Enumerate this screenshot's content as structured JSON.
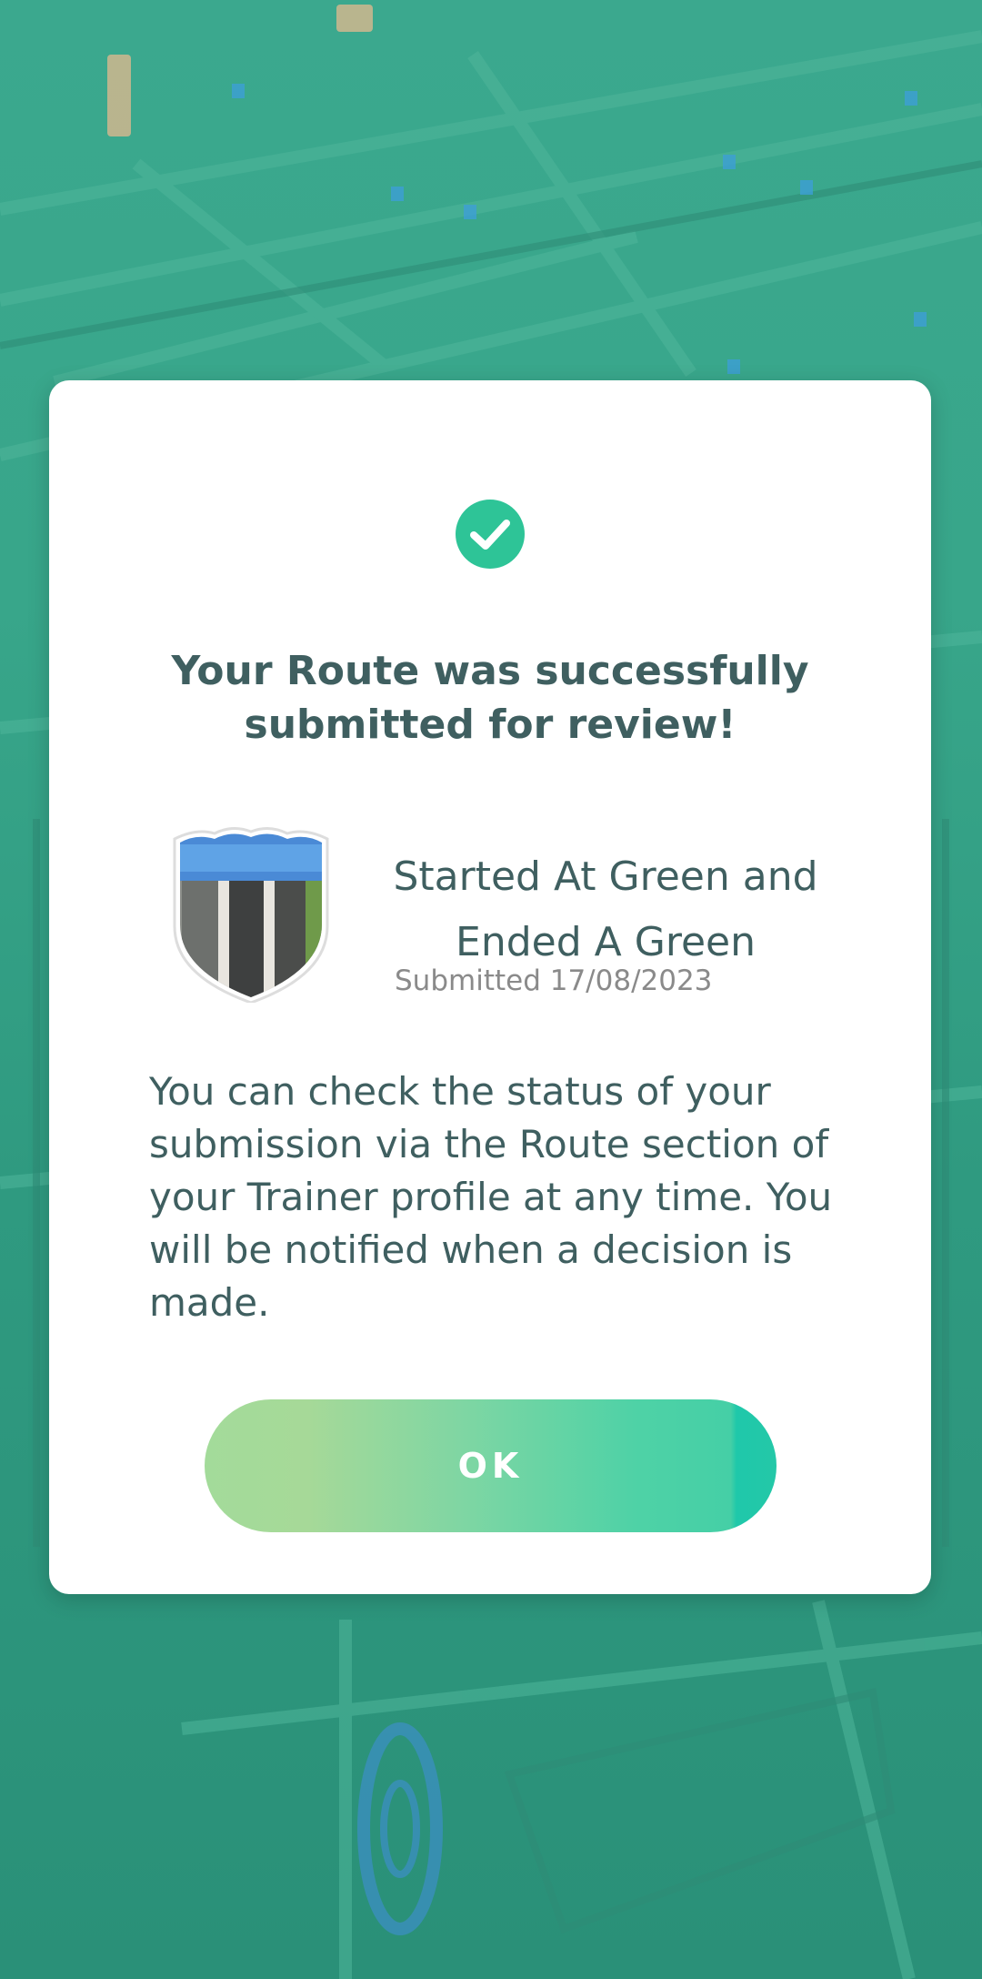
{
  "dialog": {
    "icon": "checkmark-circle-icon",
    "title": "Your Route was successfully submitted for review!",
    "route": {
      "badge_icon": "route-shield-badge-icon",
      "name": "Started At Green and Ended A Green",
      "submitted": "Submitted 17/08/2023"
    },
    "body": "You can check the status of your submission via the Route section of your Trainer profile at any time. You will be notified when a decision is made.",
    "ok_label": "OK"
  },
  "colors": {
    "accent": "#2ec497",
    "text": "#3f5f60",
    "muted": "#8a8a8a",
    "map": "#38a68a"
  }
}
